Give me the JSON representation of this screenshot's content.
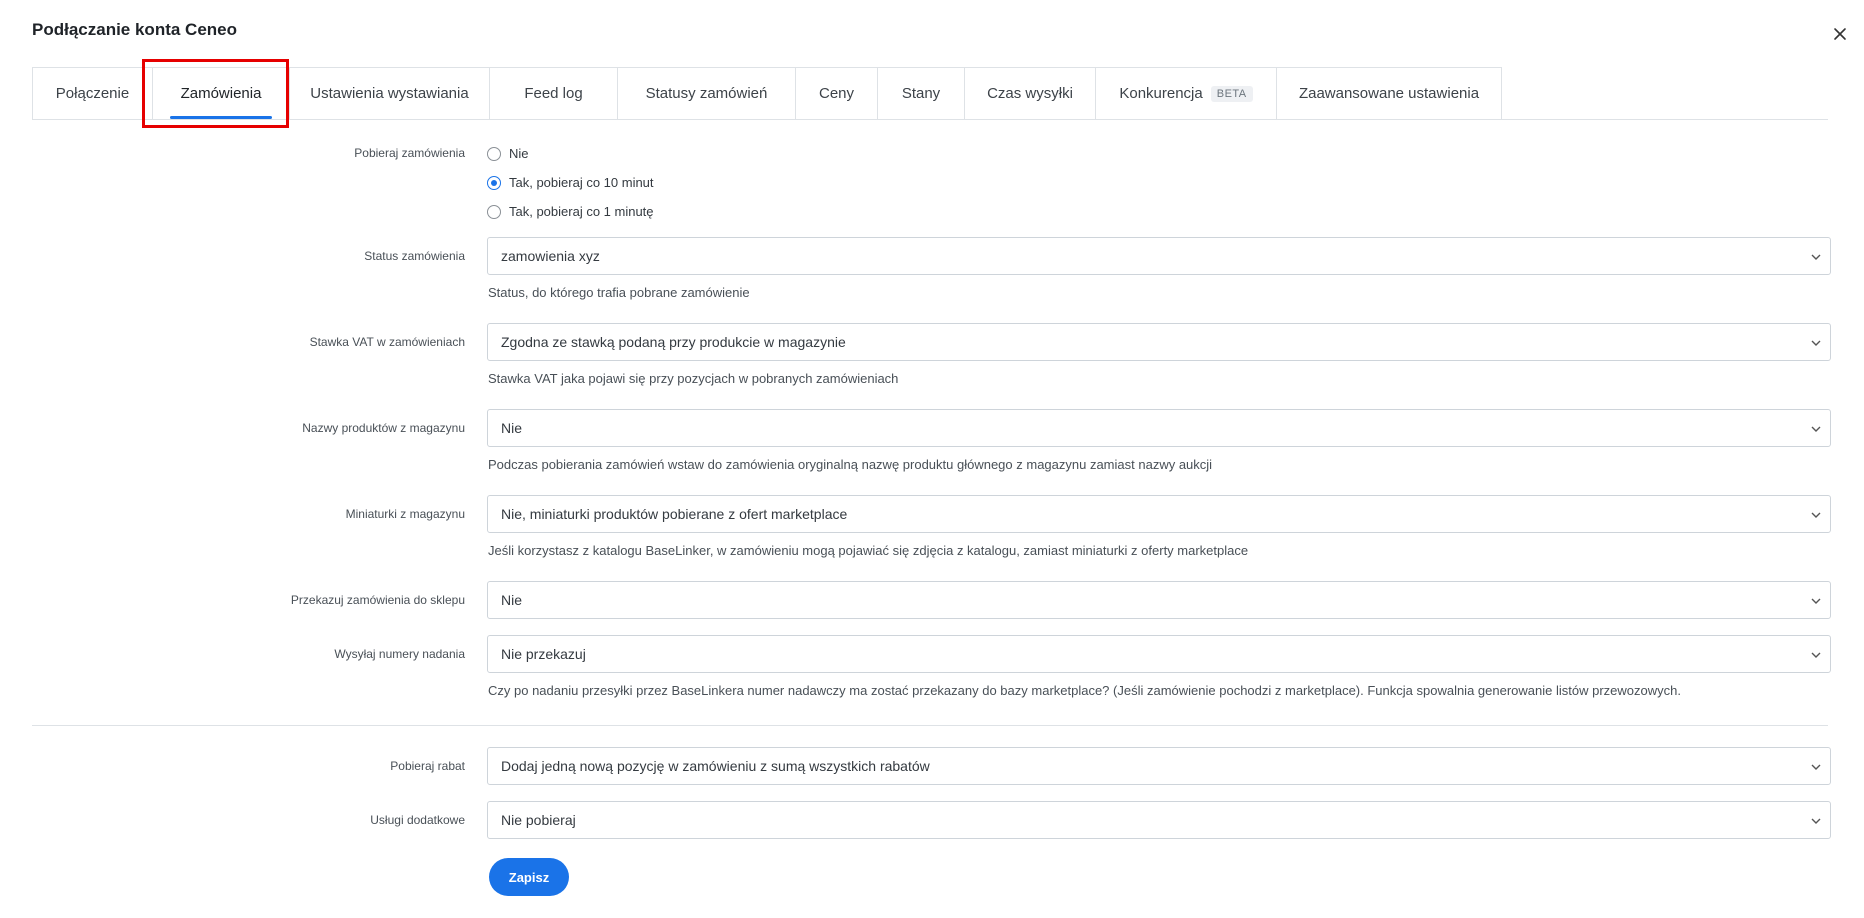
{
  "modal": {
    "title": "Podłączanie konta Ceneo"
  },
  "tabs": [
    {
      "label": "Połączenie"
    },
    {
      "label": "Zamówienia"
    },
    {
      "label": "Ustawienia wystawiania"
    },
    {
      "label": "Feed log"
    },
    {
      "label": "Statusy zamówień"
    },
    {
      "label": "Ceny"
    },
    {
      "label": "Stany"
    },
    {
      "label": "Czas wysyłki"
    },
    {
      "label": "Konkurencja",
      "badge": "BETA"
    },
    {
      "label": "Zaawansowane ustawienia"
    }
  ],
  "active_tab": "Zamówienia",
  "fields": {
    "fetch_orders": {
      "label": "Pobieraj zamówienia",
      "options": [
        "Nie",
        "Tak, pobieraj co 10 minut",
        "Tak, pobieraj co 1 minutę"
      ],
      "selected": "Tak, pobieraj co 10 minut"
    },
    "order_status": {
      "label": "Status zamówienia",
      "value": "zamowienia xyz",
      "help": "Status, do którego trafia pobrane zamówienie"
    },
    "vat_rate": {
      "label": "Stawka VAT w zamówieniach",
      "value": "Zgodna ze stawką podaną przy produkcie w magazynie",
      "help": "Stawka VAT jaka pojawi się przy pozycjach w pobranych zamówieniach"
    },
    "product_names": {
      "label": "Nazwy produktów z magazynu",
      "value": "Nie",
      "help": "Podczas pobierania zamówień wstaw do zamówienia oryginalną nazwę produktu głównego z magazynu zamiast nazwy aukcji"
    },
    "thumbnails": {
      "label": "Miniaturki z magazynu",
      "value": "Nie, miniaturki produktów pobierane z ofert marketplace",
      "help": "Jeśli korzystasz z katalogu BaseLinker, w zamówieniu mogą pojawiać się zdjęcia z katalogu, zamiast miniaturki z oferty marketplace"
    },
    "forward_orders": {
      "label": "Przekazuj zamówienia do sklepu",
      "value": "Nie"
    },
    "tracking_numbers": {
      "label": "Wysyłaj numery nadania",
      "value": "Nie przekazuj",
      "help": "Czy po nadaniu przesyłki przez BaseLinkera numer nadawczy ma zostać przekazany do bazy marketplace? (Jeśli zamówienie pochodzi z marketplace). Funkcja spowalnia generowanie listów przewozowych."
    },
    "discount": {
      "label": "Pobieraj rabat",
      "value": "Dodaj jedną nową pozycję w zamówieniu z sumą wszystkich rabatów"
    },
    "extra_services": {
      "label": "Usługi dodatkowe",
      "value": "Nie pobieraj"
    }
  },
  "actions": {
    "save_label": "Zapisz"
  },
  "colors": {
    "accent": "#1a73e8",
    "highlight": "#e60000",
    "border": "#ced4da"
  }
}
